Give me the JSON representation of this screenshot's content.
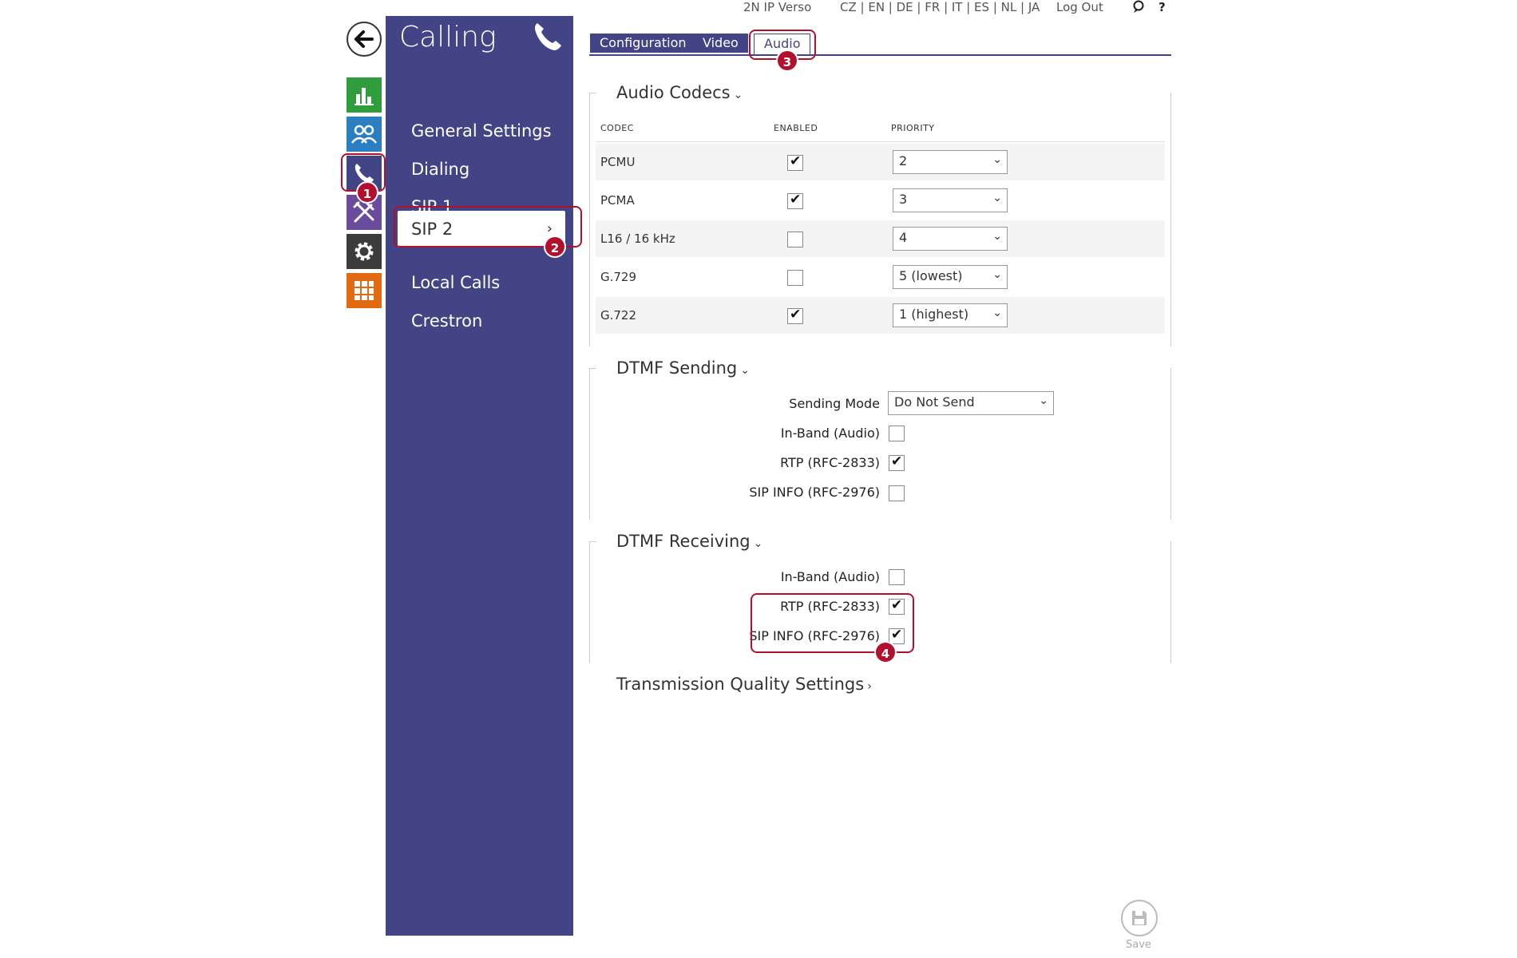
{
  "topbar": {
    "device": "2N IP Verso",
    "languages": "CZ | EN | DE | FR | IT | ES | NL | JA",
    "logout": "Log Out",
    "help": "?"
  },
  "sidebar": {
    "title": "Calling",
    "items": [
      {
        "label": "General Settings"
      },
      {
        "label": "Dialing"
      },
      {
        "label": "SIP 1"
      },
      {
        "label": "SIP 2"
      },
      {
        "label": "Local Calls"
      },
      {
        "label": "Crestron"
      }
    ]
  },
  "tabs": [
    {
      "label": "Configuration"
    },
    {
      "label": "Video"
    },
    {
      "label": "Audio"
    }
  ],
  "audio_codecs": {
    "title": "Audio Codecs",
    "headers": {
      "codec": "CODEC",
      "enabled": "ENABLED",
      "priority": "PRIORITY"
    },
    "rows": [
      {
        "codec": "PCMU",
        "enabled": true,
        "priority": "2"
      },
      {
        "codec": "PCMA",
        "enabled": true,
        "priority": "3"
      },
      {
        "codec": "L16 / 16 kHz",
        "enabled": false,
        "priority": "4"
      },
      {
        "codec": "G.729",
        "enabled": false,
        "priority": "5 (lowest)"
      },
      {
        "codec": "G.722",
        "enabled": true,
        "priority": "1 (highest)"
      }
    ]
  },
  "dtmf_sending": {
    "title": "DTMF Sending",
    "sending_mode_label": "Sending Mode",
    "sending_mode_value": "Do Not Send",
    "inband_label": "In-Band (Audio)",
    "inband": false,
    "rtp_label": "RTP (RFC-2833)",
    "rtp": true,
    "sipinfo_label": "SIP INFO (RFC-2976)",
    "sipinfo": false
  },
  "dtmf_receiving": {
    "title": "DTMF Receiving",
    "inband_label": "In-Band (Audio)",
    "inband": false,
    "rtp_label": "RTP (RFC-2833)",
    "rtp": true,
    "sipinfo_label": "SIP INFO (RFC-2976)",
    "sipinfo": true
  },
  "transmission": {
    "title": "Transmission Quality Settings"
  },
  "annotations": {
    "b1": "1",
    "b2": "2",
    "b3": "3",
    "b4": "4"
  },
  "save": {
    "label": "Save"
  },
  "colors": {
    "brand": "#424485",
    "highlight": "#b3102e",
    "status_green": "#2f9d3c",
    "users_blue": "#2a7fc1",
    "tools_purple": "#6a4c9c",
    "settings_dark": "#3c3c3c",
    "apps_orange": "#e06b12"
  }
}
